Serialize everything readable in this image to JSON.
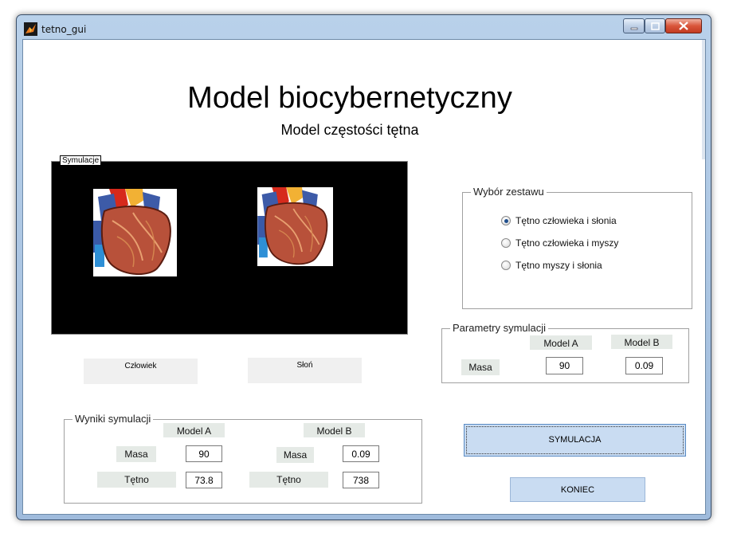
{
  "window": {
    "title": "tetno_gui"
  },
  "header": {
    "title": "Model biocybernetyczny",
    "subtitle": "Model częstości tętna"
  },
  "simulation": {
    "label": "Symulacje",
    "left_label": "Człowiek",
    "right_label": "Słoń"
  },
  "set_choice": {
    "label": "Wybór zestawu",
    "options": [
      {
        "label": "Tętno człowieka i słonia",
        "checked": true
      },
      {
        "label": "Tętno człowieka i myszy",
        "checked": false
      },
      {
        "label": "Tętno myszy i słonia",
        "checked": false
      }
    ]
  },
  "params": {
    "label": "Parametry symulacji",
    "model_a": "Model A",
    "model_b": "Model B",
    "row_label": "Masa",
    "value_a": "90",
    "value_b": "0.09"
  },
  "results": {
    "label": "Wyniki symulacji",
    "model_a": "Model A",
    "model_b": "Model B",
    "mass_label": "Masa",
    "pulse_label": "Tętno",
    "mass_a": "90",
    "mass_b": "0.09",
    "pulse_a": "73.8",
    "pulse_b": "738"
  },
  "buttons": {
    "simulate": "SYMULACJA",
    "exit": "KONIEC"
  },
  "colors": {
    "accent_button": "#c9dcf2",
    "header_cell": "#e5eae6",
    "sim_background": "#000000"
  }
}
